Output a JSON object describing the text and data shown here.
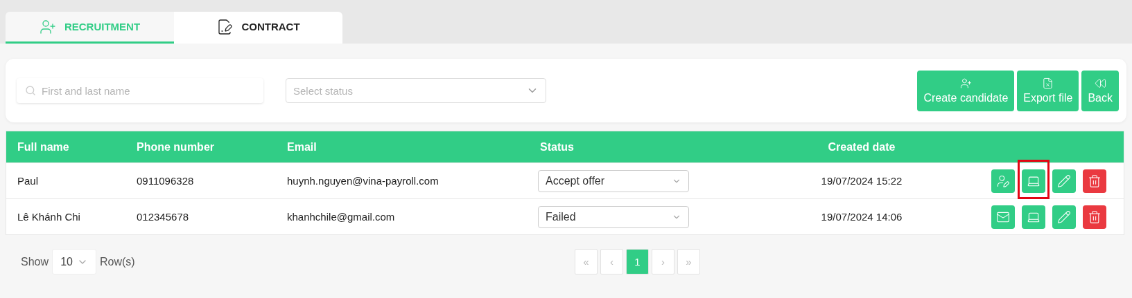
{
  "tabs": [
    {
      "label": "RECRUITMENT",
      "kind": "recruit",
      "selected": true
    },
    {
      "label": "CONTRACT",
      "kind": "contract",
      "selected": false
    }
  ],
  "filters": {
    "search": {
      "placeholder": "First and last name"
    },
    "status": {
      "placeholder": "Select status"
    }
  },
  "toolbar": [
    {
      "label": "Create candidate",
      "kind": "create"
    },
    {
      "label": "Export file",
      "kind": "export"
    },
    {
      "label": "Back",
      "kind": "back"
    }
  ],
  "table": {
    "columns": [
      "Full name",
      "Phone number",
      "Email",
      "Status",
      "Created date"
    ],
    "rows": [
      {
        "name": "Paul",
        "phone": "0911096328",
        "email": "huynh.nguyen@vina-payroll.com",
        "status": "Accept offer",
        "created": "19/07/2024 15:22",
        "actions": [
          {
            "kind": "assign",
            "highlighted": false
          },
          {
            "kind": "code",
            "highlighted": true
          },
          {
            "kind": "edit",
            "highlighted": false
          },
          {
            "kind": "delete",
            "highlighted": false
          }
        ]
      },
      {
        "name": "Lê Khánh Chi",
        "phone": "012345678",
        "email": "khanhchile@gmail.com",
        "status": "Failed",
        "created": "19/07/2024 14:06",
        "actions": [
          {
            "kind": "email",
            "highlighted": false
          },
          {
            "kind": "code",
            "highlighted": false
          },
          {
            "kind": "edit",
            "highlighted": false
          },
          {
            "kind": "delete",
            "highlighted": false
          }
        ]
      }
    ]
  },
  "footer": {
    "show_label": "Show",
    "page_size": "10",
    "rows_label": "Row(s)",
    "pages": [
      {
        "label": "«",
        "selected": false
      },
      {
        "label": "‹",
        "selected": false
      },
      {
        "label": "1",
        "selected": true
      },
      {
        "label": "›",
        "selected": false
      },
      {
        "label": "»",
        "selected": false
      }
    ]
  }
}
